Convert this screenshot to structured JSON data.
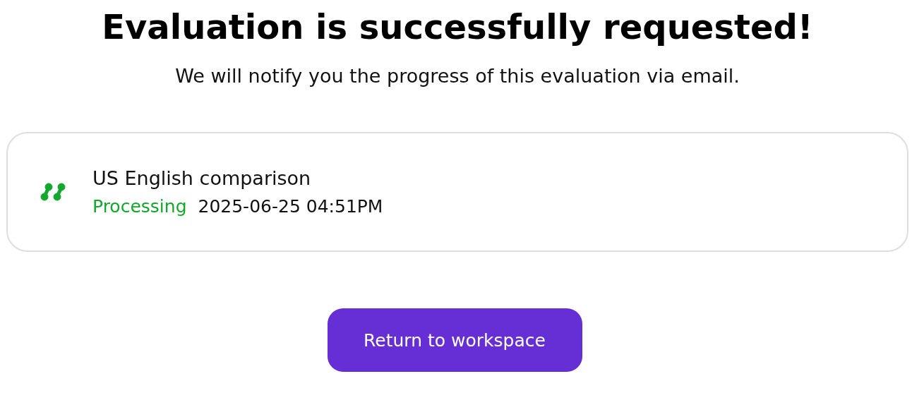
{
  "title": "Evaluation is successfully requested!",
  "subtitle": "We will notify you the progress of this evaluation via email.",
  "evaluations": [
    {
      "name": "US English comparison",
      "status": "Processing",
      "color": "#13a82d",
      "timestamp": "2025-06-25 04:51PM"
    }
  ],
  "button": {
    "label": "Return to workspace"
  }
}
